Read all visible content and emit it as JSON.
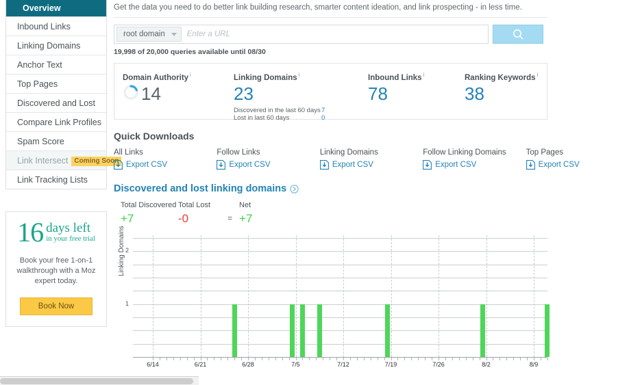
{
  "sidebar": {
    "items": [
      {
        "label": "Overview",
        "state": "active"
      },
      {
        "label": "Inbound Links",
        "state": "normal"
      },
      {
        "label": "Linking Domains",
        "state": "normal"
      },
      {
        "label": "Anchor Text",
        "state": "normal"
      },
      {
        "label": "Top Pages",
        "state": "normal"
      },
      {
        "label": "Discovered and Lost",
        "state": "normal"
      },
      {
        "label": "Compare Link Profiles",
        "state": "normal"
      },
      {
        "label": "Spam Score",
        "state": "disabled",
        "badge": "Coming Soon"
      },
      {
        "label": "Link Tracking Lists",
        "state": "normal"
      }
    ],
    "trial": {
      "number": "16",
      "days_left": "days left",
      "subtitle": "in your free trial",
      "copy_line1": "Book your free 1-on-1",
      "copy_line2": "walkthrough with a Moz",
      "copy_line3": "expert today.",
      "button": "Book Now"
    }
  },
  "header": {
    "intro": "Get the data you need to do better link building research, smarter content ideation, and link prospecting - in less time.",
    "scope_selected": "root domain",
    "url_placeholder": "Enter a URL",
    "url_value": "",
    "search_icon": "search-icon",
    "quota": "19,998 of 20,000 queries available until 08/30"
  },
  "metrics": [
    {
      "label": "Domain Authority",
      "info": "i",
      "value": "14",
      "style": "donut"
    },
    {
      "label": "Linking Domains",
      "info": "i",
      "value": "23",
      "style": "plain",
      "sublines": [
        {
          "label": "Discovered in the last 60 days",
          "value": "7"
        },
        {
          "label": "Lost in last 60 days",
          "value": "0"
        }
      ]
    },
    {
      "label": "Inbound Links",
      "info": "i",
      "value": "78",
      "style": "plain"
    },
    {
      "label": "Ranking Keywords",
      "info": "i",
      "value": "38",
      "style": "plain"
    }
  ],
  "quick_downloads": {
    "title": "Quick Downloads",
    "items": [
      {
        "name": "All Links",
        "link": "Export CSV"
      },
      {
        "name": "Follow Links",
        "link": "Export CSV"
      },
      {
        "name": "Linking Domains",
        "link": "Export CSV"
      },
      {
        "name": "Follow Linking Domains",
        "link": "Export CSV"
      },
      {
        "name": "Top Pages",
        "link": "Export CSV"
      }
    ]
  },
  "discovered": {
    "title": "Discovered and lost linking domains",
    "totals": [
      {
        "label": "Total Discovered",
        "value": "+7",
        "color": "green"
      },
      {
        "label": "Total Lost",
        "value": "-0",
        "color": "red"
      },
      {
        "label": "Net",
        "value": "+7",
        "color": "green"
      }
    ],
    "equals": "="
  },
  "colors": {
    "sidebar_active": "#0f6c80",
    "accent_blue": "#2383b4",
    "bar_green": "#4ed658",
    "total_lost_red": "#f03c3c",
    "badge_yellow": "#fcd265",
    "trial_teal": "#18a58b",
    "search_button": "#a5dbf2"
  },
  "chart_data": {
    "type": "bar",
    "title": "Discovered and lost linking domains",
    "xlabel": "",
    "ylabel": "Linking Domains",
    "ylim": [
      0,
      2.3
    ],
    "yticks": [
      1,
      2
    ],
    "grid": true,
    "legend": null,
    "x_tick_labels": [
      "6/14",
      "6/21",
      "6/28",
      "7/5",
      "7/12",
      "7/19",
      "7/26",
      "8/2",
      "8/9"
    ],
    "categories": [
      "6/26",
      "7/4",
      "7/5",
      "7/7",
      "7/18",
      "8/1",
      "8/11"
    ],
    "values": [
      1,
      1,
      1,
      1,
      1,
      1,
      1
    ],
    "series": [
      {
        "name": "Discovered",
        "color": "#4ed658",
        "values": [
          1,
          1,
          1,
          1,
          1,
          1,
          1
        ]
      }
    ]
  }
}
